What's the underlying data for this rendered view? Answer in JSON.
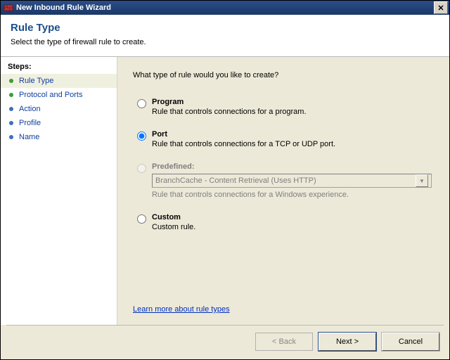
{
  "window": {
    "title": "New Inbound Rule Wizard"
  },
  "header": {
    "heading": "Rule Type",
    "subtitle": "Select the type of firewall rule to create."
  },
  "sidebar": {
    "heading": "Steps:",
    "items": [
      {
        "label": "Rule Type",
        "state": "current"
      },
      {
        "label": "Protocol and Ports",
        "state": "done"
      },
      {
        "label": "Action",
        "state": "future"
      },
      {
        "label": "Profile",
        "state": "future"
      },
      {
        "label": "Name",
        "state": "future"
      }
    ]
  },
  "content": {
    "prompt": "What type of rule would you like to create?",
    "options": {
      "program": {
        "title": "Program",
        "desc": "Rule that controls connections for a program."
      },
      "port": {
        "title": "Port",
        "desc": "Rule that controls connections for a TCP or UDP port."
      },
      "predefined": {
        "title": "Predefined:",
        "selected_value": "BranchCache - Content Retrieval (Uses HTTP)",
        "desc": "Rule that controls connections for a Windows experience."
      },
      "custom": {
        "title": "Custom",
        "desc": "Custom rule."
      }
    },
    "selected_option": "port",
    "learn_more": "Learn more about rule types"
  },
  "buttons": {
    "back": "< Back",
    "next": "Next >",
    "cancel": "Cancel"
  }
}
